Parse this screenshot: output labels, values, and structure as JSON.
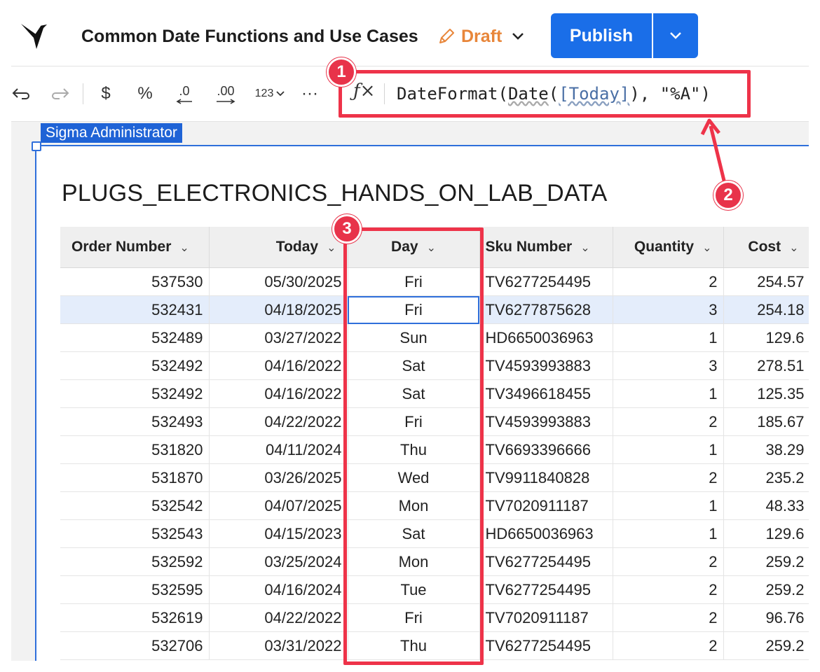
{
  "header": {
    "title": "Common Date Functions and Use Cases",
    "status": "Draft",
    "publish_label": "Publish"
  },
  "toolbar": {
    "undo": "⮌",
    "redo": "⮎",
    "currency": "$",
    "percent": "%",
    "decrease_decimals": ".0",
    "increase_decimals": ".00",
    "number_format": "123",
    "more": "···",
    "fx": "ƒ×",
    "formula": {
      "prefix": "DateFormat(",
      "func": "Date",
      "open": "(",
      "ref": "[Today]",
      "suffix": "), \"%A\")"
    }
  },
  "element": {
    "owner_tag": "Sigma Administrator",
    "title": "PLUGS_ELECTRONICS_HANDS_ON_LAB_DATA"
  },
  "table": {
    "columns": [
      "Order Number",
      "Today",
      "Day",
      "Sku Number",
      "Quantity",
      "Cost"
    ],
    "rows": [
      [
        "537530",
        "05/30/2025",
        "Fri",
        "TV6277254495",
        "2",
        "254.57"
      ],
      [
        "532431",
        "04/18/2025",
        "Fri",
        "TV6277875628",
        "3",
        "254.18"
      ],
      [
        "532489",
        "03/27/2022",
        "Sun",
        "HD6650036963",
        "1",
        "129.6"
      ],
      [
        "532492",
        "04/16/2022",
        "Sat",
        "TV4593993883",
        "3",
        "278.51"
      ],
      [
        "532492",
        "04/16/2022",
        "Sat",
        "TV3496618455",
        "1",
        "125.35"
      ],
      [
        "532493",
        "04/22/2022",
        "Fri",
        "TV4593993883",
        "2",
        "185.67"
      ],
      [
        "531820",
        "04/11/2024",
        "Thu",
        "TV6693396666",
        "1",
        "38.29"
      ],
      [
        "531870",
        "03/26/2025",
        "Wed",
        "TV9911840828",
        "2",
        "235.2"
      ],
      [
        "532542",
        "04/07/2025",
        "Mon",
        "TV7020911187",
        "1",
        "48.33"
      ],
      [
        "532543",
        "04/15/2023",
        "Sat",
        "HD6650036963",
        "1",
        "129.6"
      ],
      [
        "532592",
        "03/25/2024",
        "Mon",
        "TV6277254495",
        "2",
        "259.2"
      ],
      [
        "532595",
        "04/16/2024",
        "Tue",
        "TV6277254495",
        "2",
        "259.2"
      ],
      [
        "532619",
        "04/22/2022",
        "Fri",
        "TV7020911187",
        "2",
        "96.76"
      ],
      [
        "532706",
        "03/31/2022",
        "Thu",
        "TV6277254495",
        "2",
        "259.2"
      ]
    ]
  },
  "annotations": {
    "one": "1",
    "two": "2",
    "three": "3",
    "color": "#ee3349"
  },
  "colors": {
    "accent": "#1a6ee8",
    "draft": "#e8863a",
    "selection": "#2f6fdb"
  }
}
